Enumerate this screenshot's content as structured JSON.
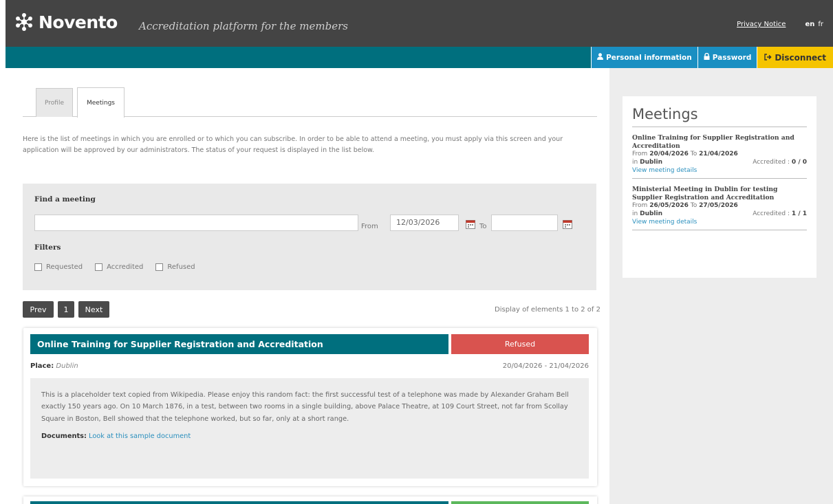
{
  "brand": {
    "name": "Novento",
    "tagline": "Accreditation platform for the members"
  },
  "top_links": {
    "privacy": "Privacy Notice",
    "lang_active": "en",
    "lang_other": "fr"
  },
  "nav": {
    "personal_info": "Personal information",
    "password": "Password",
    "disconnect": "Disconnect"
  },
  "tabs": [
    {
      "label": "Profile"
    },
    {
      "label": "Meetings"
    }
  ],
  "intro": "Here is the list of meetings in which you are enrolled or to which you can subscribe. In order to be able to attend a meeting, you must apply via this screen and your application will be approved by our administrators. The status of your request is displayed in the list below.",
  "finder": {
    "title": "Find a meeting",
    "search_value": "",
    "from_label": "From",
    "from_value": "12/03/2026",
    "to_label": "To",
    "to_value": "",
    "filters_title": "Filters",
    "filters": [
      {
        "label": "Requested"
      },
      {
        "label": "Accredited"
      },
      {
        "label": "Refused"
      }
    ]
  },
  "pager": {
    "prev": "Prev",
    "page": "1",
    "next": "Next",
    "display": "Display of elements 1 to 2 of 2"
  },
  "meetings": [
    {
      "title": "Online Training for Supplier Registration and Accreditation",
      "status": "Refused",
      "status_color": "#d9534f",
      "place_label": "Place:",
      "place": "Dublin",
      "dates": "20/04/2026 - 21/04/2026",
      "description": "This is a placeholder text copied from Wikipedia. Please enjoy this random fact: the first successful test of a telephone was made by Alexander Graham Bell exactly 150 years ago. On 10 March 1876, in a test, between two rooms in a single building, above Palace Theatre, at 109 Court Street, not far from Scollay Square in Boston, Bell showed that the telephone worked, but so far, only at a short range.",
      "documents_label": "Documents:",
      "document_link": "Look at this sample document"
    }
  ],
  "sidebar": {
    "title": "Meetings",
    "items": [
      {
        "name": "Online Training for Supplier Registration and Accreditation",
        "from_label": "From",
        "from": "20/04/2026",
        "to_label": "To",
        "to": "21/04/2026",
        "in_label": "in",
        "place": "Dublin",
        "accredited_label": "Accredited :",
        "accredited": "0 / 0",
        "link": "View meeting details"
      },
      {
        "name": "Ministerial Meeting in Dublin for testing Supplier Registration and Accreditation",
        "from_label": "From",
        "from": "26/05/2026",
        "to_label": "To",
        "to": "27/05/2026",
        "in_label": "in",
        "place": "Dublin",
        "accredited_label": "Accredited :",
        "accredited": "1 / 1",
        "link": "View meeting details"
      }
    ]
  },
  "colors": {
    "teal": "#006f7e",
    "blue": "#1a8fc2",
    "yellow": "#f5c400",
    "refused": "#d9534f",
    "accredited": "#5cb85c"
  }
}
